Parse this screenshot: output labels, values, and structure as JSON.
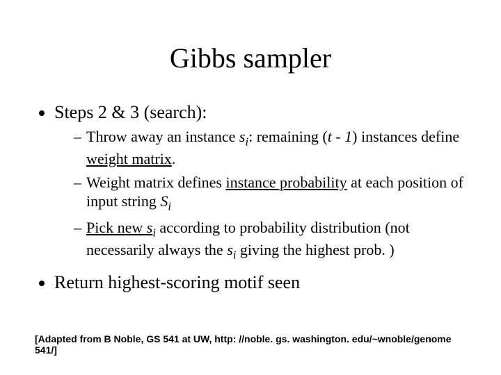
{
  "title": "Gibbs sampler",
  "bullets": {
    "b1": "Steps 2 & 3 (search):",
    "sub1": {
      "pre": "Throw away an instance ",
      "var1a": "s",
      "var1b": "i",
      "mid": ": remaining (",
      "var2a": "t",
      "dash": " - ",
      "var2b": "1",
      "post1": ") instances define ",
      "weight": "weight matrix",
      "end": "."
    },
    "sub2": {
      "pre": "Weight matrix defines ",
      "ip": "instance probability",
      "mid": " at each position of input string ",
      "var1a": "S",
      "var1b": "i"
    },
    "sub3": {
      "pick": "Pick new ",
      "var1a": "s",
      "var1b": "i",
      "mid": " according to probability distribution (not necessarily always the ",
      "var2a": "s",
      "var2b": "i",
      "end": "  giving the highest prob. )"
    },
    "b2": "Return highest-scoring motif seen"
  },
  "footer": "[Adapted from B Noble, GS 541 at UW, http: //noble. gs. washington. edu/~wnoble/genome 541/]"
}
